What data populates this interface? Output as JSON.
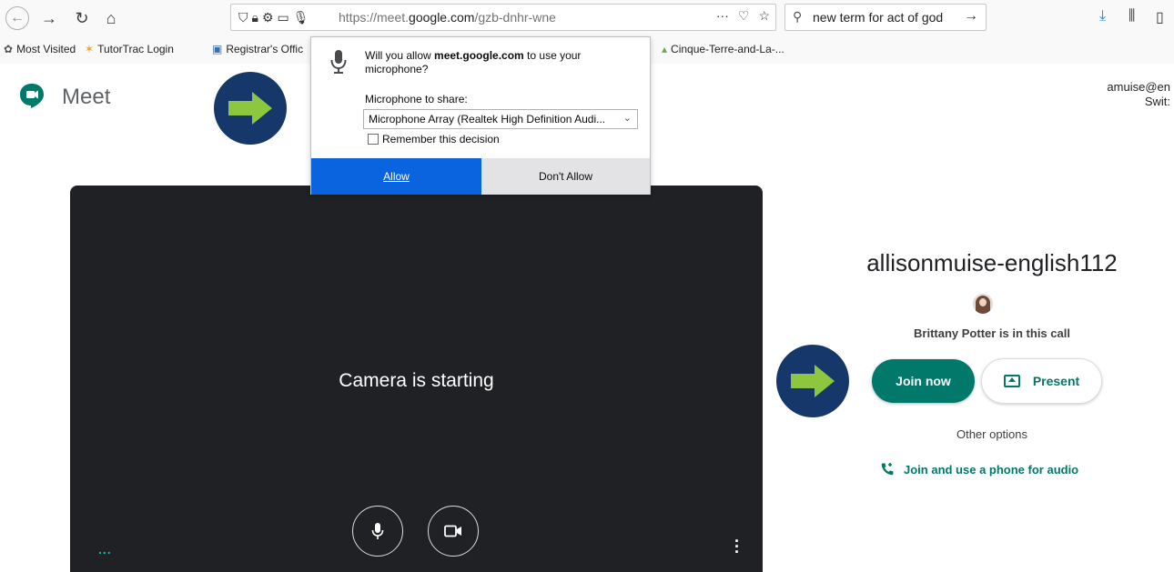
{
  "browser": {
    "url_prefix": "https://meet.",
    "url_host": "google.com",
    "url_path": "/gzb-dnhr-wne",
    "page_actions_icon": "···",
    "search_query": "new term for act of god"
  },
  "bookmarks": [
    {
      "icon": "gear-icon",
      "glyph": "✿",
      "color": "#555555",
      "label": "Most Visited"
    },
    {
      "icon": "star-icon",
      "glyph": "✶",
      "color": "#e8a23a",
      "label": "TutorTrac Login"
    },
    {
      "icon": "page-icon",
      "glyph": "▣",
      "color": "#3b6fa8",
      "label": "Registrar's Offic"
    },
    {
      "icon": "landscape-icon",
      "glyph": "▴",
      "color": "#6aa84f",
      "label": "Cinque-Terre-and-La-..."
    }
  ],
  "meet": {
    "name": "Meet",
    "account_email": "amuise@en",
    "account_switch": "Swit:"
  },
  "popup": {
    "question_prefix": "Will you allow ",
    "question_host": "meet.google.com",
    "question_suffix": " to use your microphone?",
    "mic_label": "Microphone to share:",
    "mic_selected": "Microphone Array (Realtek High Definition Audi...",
    "remember_label": "Remember this decision",
    "allow_label": "Allow",
    "deny_label": "Don't Allow"
  },
  "video": {
    "status": "Camera is starting",
    "dots": "..."
  },
  "join_panel": {
    "room_name": "allisonmuise-english112",
    "in_call": "Brittany Potter is in this call",
    "join_label": "Join now",
    "present_label": "Present",
    "other_options": "Other options",
    "phone_label": "Join and use a phone for audio"
  },
  "colors": {
    "meet_green": "#00796b",
    "allow_blue": "#0a64e0",
    "badge_navy": "#163769",
    "arrow_green": "#8dc63f",
    "video_bg": "#202124"
  }
}
